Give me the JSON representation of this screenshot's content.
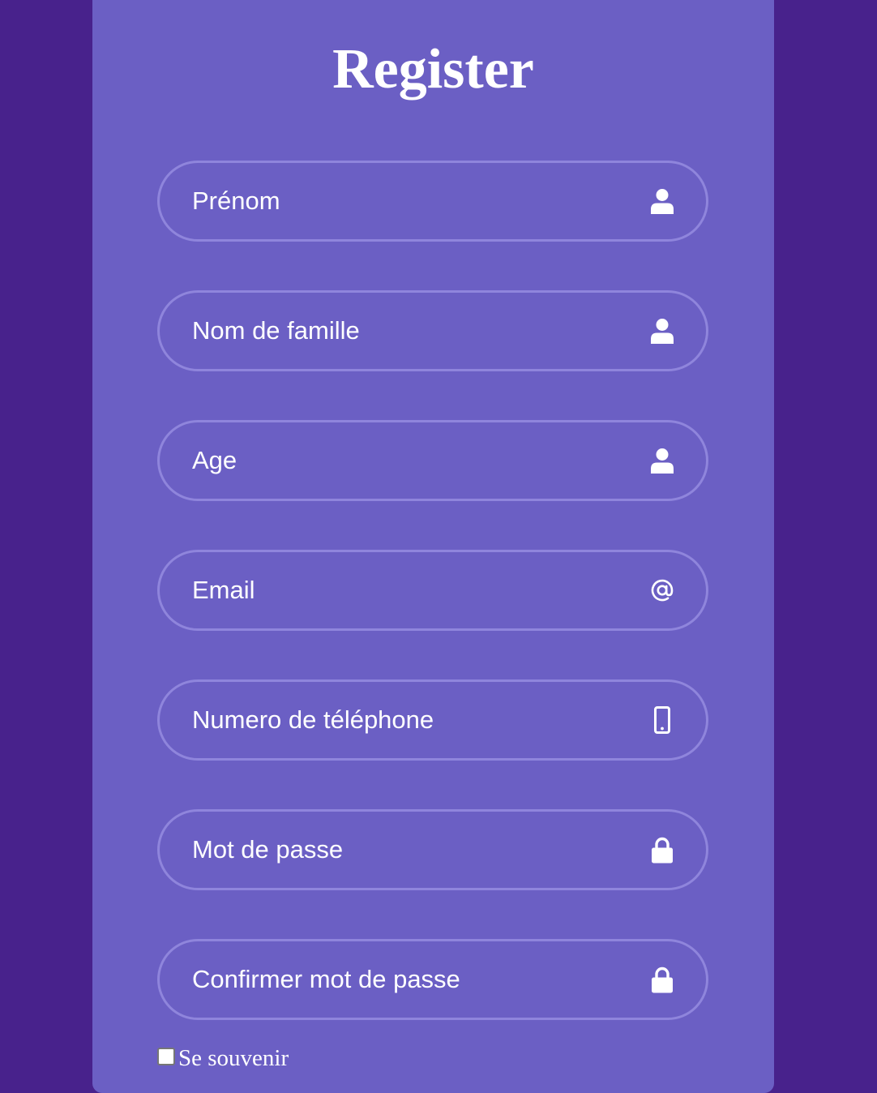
{
  "form": {
    "title": "Register",
    "fields": [
      {
        "placeholder": "Prénom",
        "icon": "user-icon"
      },
      {
        "placeholder": "Nom de famille",
        "icon": "user-icon"
      },
      {
        "placeholder": "Age",
        "icon": "user-icon"
      },
      {
        "placeholder": "Email",
        "icon": "at-sign-icon"
      },
      {
        "placeholder": "Numero de téléphone",
        "icon": "mobile-phone-icon"
      },
      {
        "placeholder": "Mot de passe",
        "icon": "lock-icon"
      },
      {
        "placeholder": "Confirmer mot de passe",
        "icon": "lock-icon"
      }
    ],
    "remember_label": "Se souvenir"
  },
  "colors": {
    "page_background": "#48228c",
    "card_background": "#6b5fc4",
    "field_border": "#8f85dc",
    "text": "#ffffff"
  }
}
